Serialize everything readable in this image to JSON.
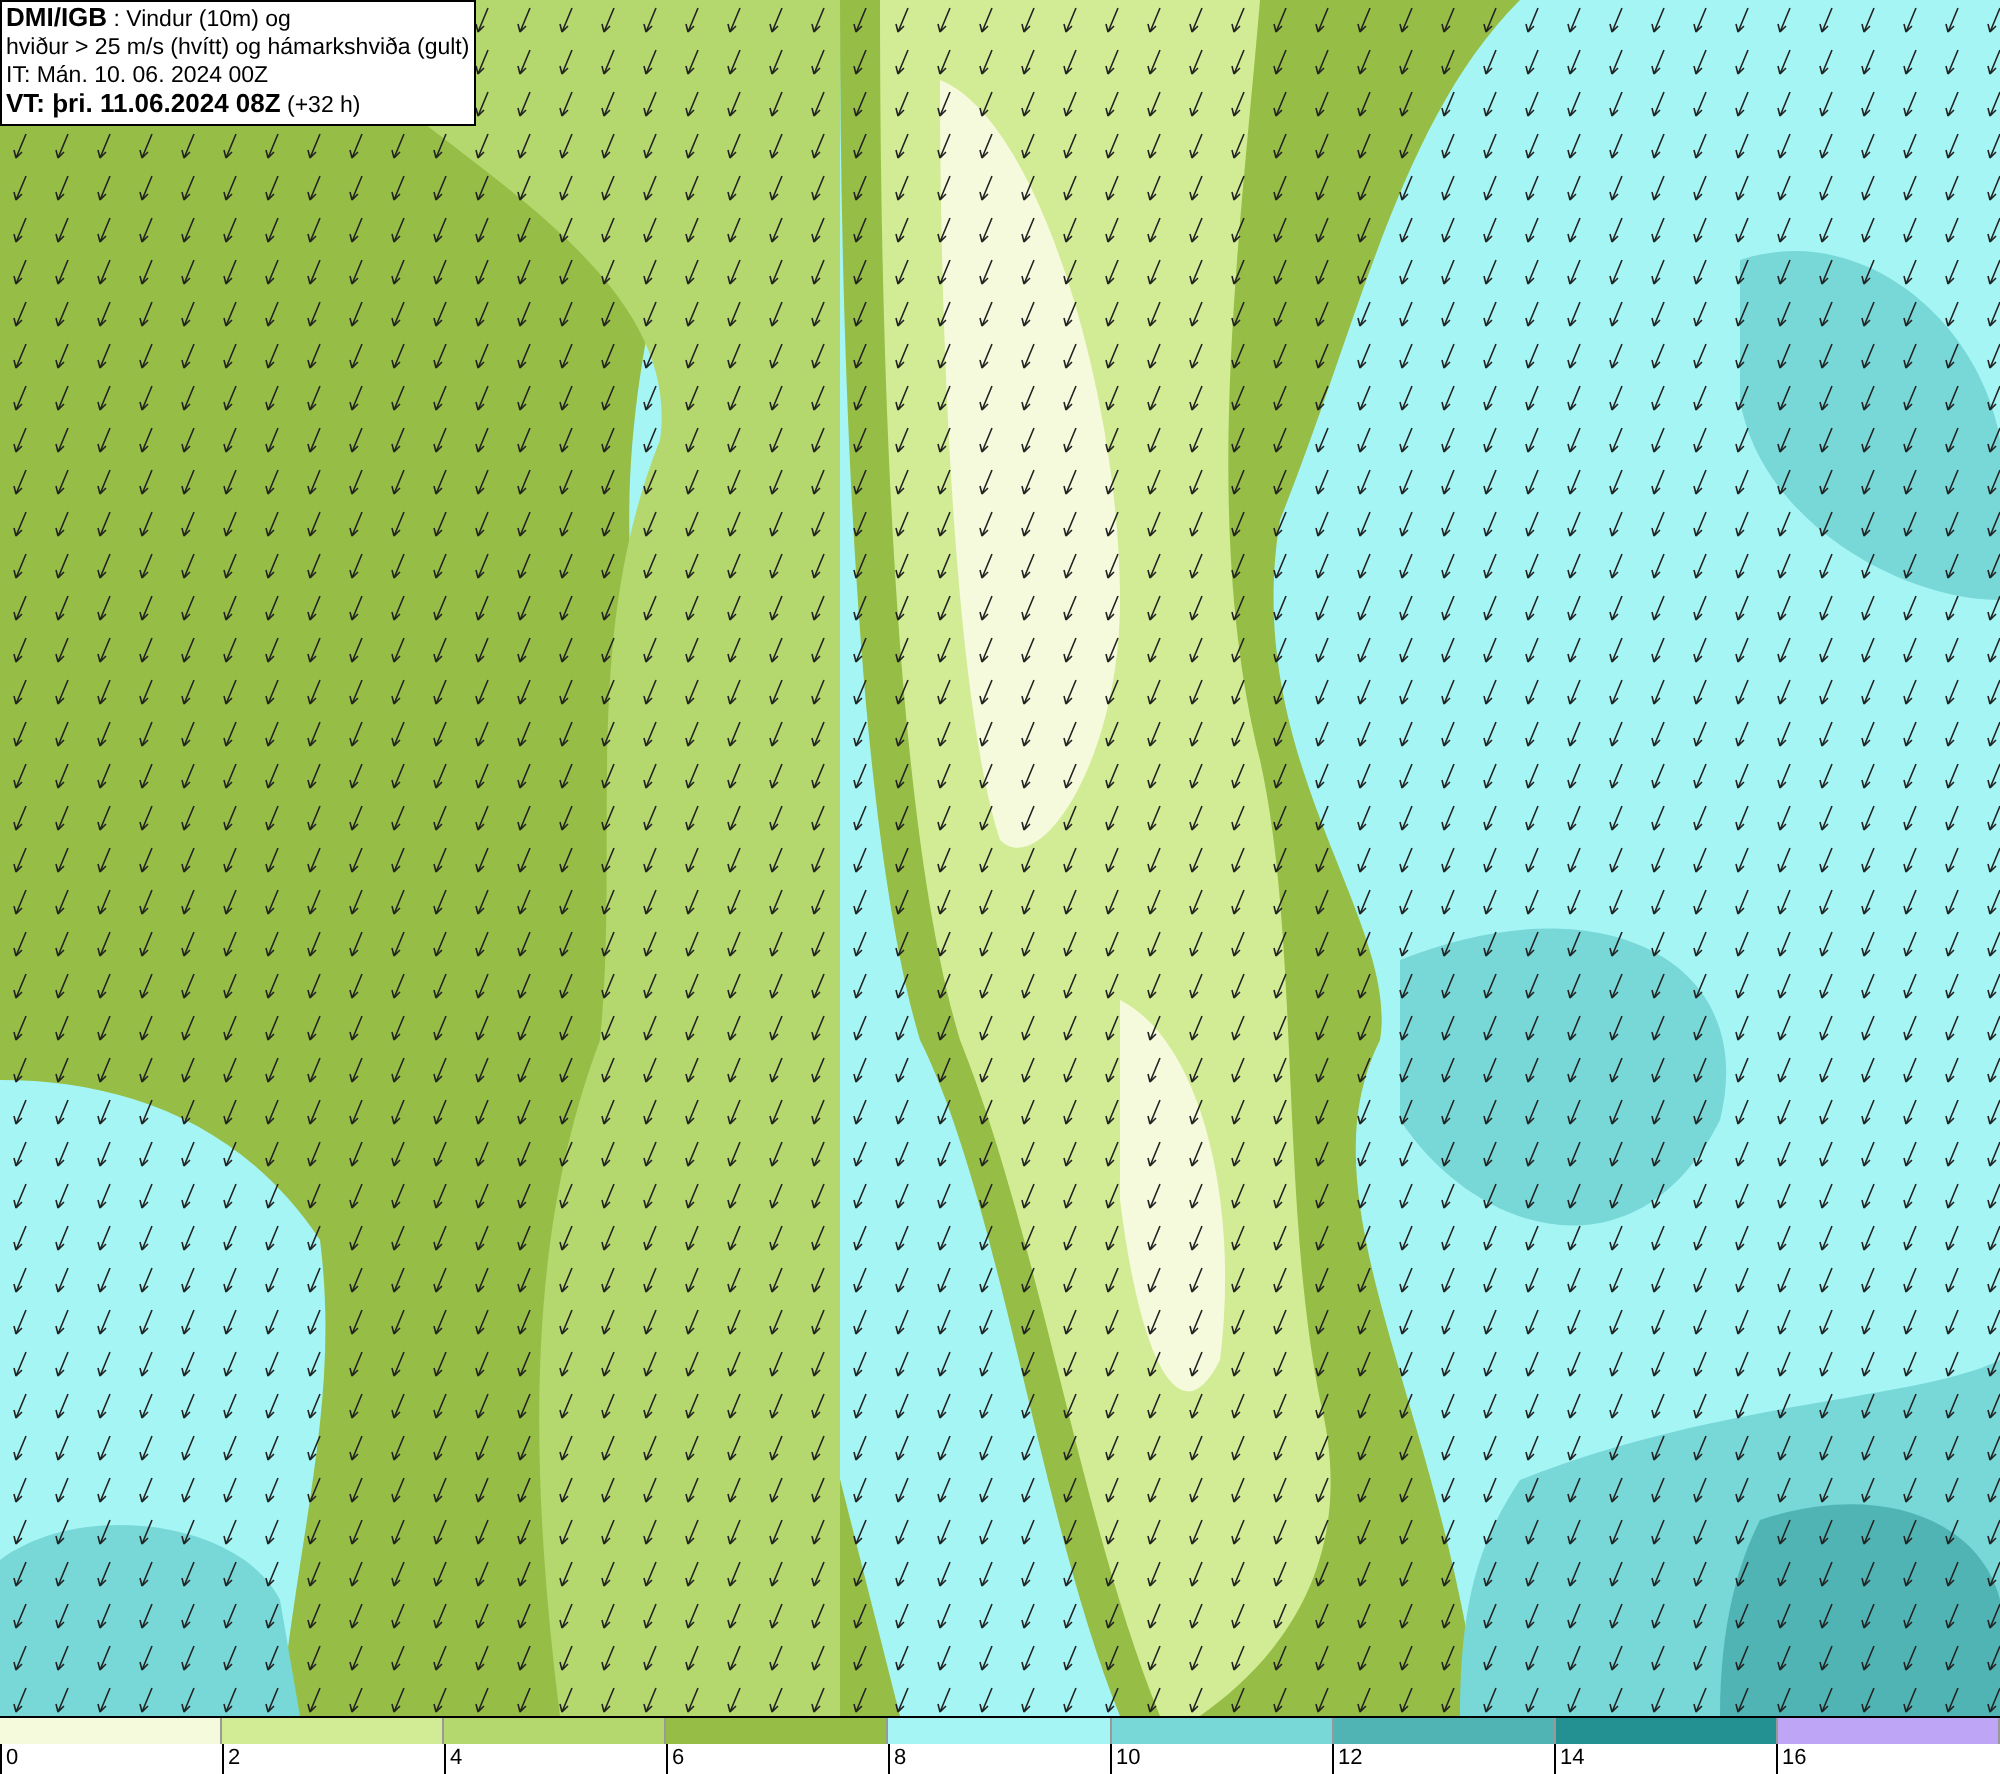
{
  "info_box": {
    "lines": [
      "**DMI/IGB** : Vindur (10m) og",
      "hviður > 25 m/s (hvítt) og hámarkshviða (gult)",
      "IT: Mán. 10. 06. 2024 00Z",
      "**VT: þri. 11.06.2024 08Z** (+32 h)"
    ]
  },
  "legend": {
    "swatches": [
      {
        "color": "#f5fadc"
      },
      {
        "color": "#d2ec96"
      },
      {
        "color": "#b4d76e"
      },
      {
        "color": "#96be46"
      },
      {
        "color": "#a5f5f5"
      },
      {
        "color": "#78d7d7"
      },
      {
        "color": "#50b4b4"
      },
      {
        "color": "#239191"
      },
      {
        "color": "#bea5f5"
      }
    ],
    "ticks": [
      "0",
      "2",
      "4",
      "6",
      "8",
      "10",
      "12",
      "14",
      "16"
    ]
  }
}
